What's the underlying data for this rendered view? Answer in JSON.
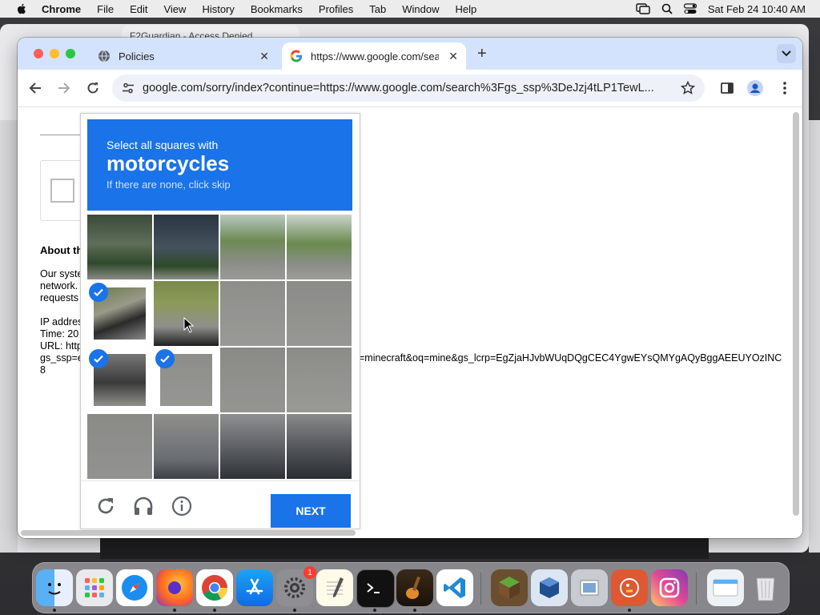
{
  "menubar": {
    "app_name": "Chrome",
    "items": [
      "File",
      "Edit",
      "View",
      "History",
      "Bookmarks",
      "Profiles",
      "Tab",
      "Window",
      "Help"
    ],
    "datetime": "Sat Feb 24  10:40 AM"
  },
  "background_window": {
    "tab_title": "F2Guardian - Access Denied"
  },
  "tabs": [
    {
      "title": "Policies",
      "icon": "globe-icon"
    },
    {
      "title": "https://www.google.com/sear",
      "icon": "google-icon"
    }
  ],
  "omnibox": {
    "url": "google.com/sorry/index?continue=https://www.google.com/search%3Fgs_ssp%3DeJzj4tLP1TewL..."
  },
  "page": {
    "about_heading": "About th",
    "lines": [
      "Our syste",
      "network.",
      "requests",
      "",
      "IP addres",
      "Time: 20",
      "URL: http",
      "gs_ssp=e",
      "8"
    ],
    "url_tail": "=minecraft&oq=mine&gs_lcrp=EgZjaHJvbWUqDQgCEC4YgwEYsQMYgAQyBggAEEUYOzINC"
  },
  "captcha": {
    "instruction_line1": "Select all squares with",
    "target": "motorcycles",
    "instruction_line3": "If there are none, click skip",
    "selected_tiles": [
      4,
      8,
      9
    ],
    "next_label": "NEXT",
    "reload_icon": "reload-icon",
    "audio_icon": "headphones-icon",
    "info_icon": "info-icon"
  },
  "dock": {
    "apps": [
      "Finder",
      "Launchpad",
      "Safari",
      "Firefox",
      "Chrome",
      "App Store",
      "System Settings",
      "TextEdit",
      "Terminal",
      "GarageBand",
      "Visual Studio Code",
      "Minecraft",
      "VirtualBox",
      "Preview",
      "DuckDuckGo",
      "Instagram",
      "Downloads",
      "Trash"
    ],
    "system_settings_badge": "1"
  },
  "colors": {
    "accent": "#1a73e8",
    "tabstrip": "#d3e3fd"
  }
}
